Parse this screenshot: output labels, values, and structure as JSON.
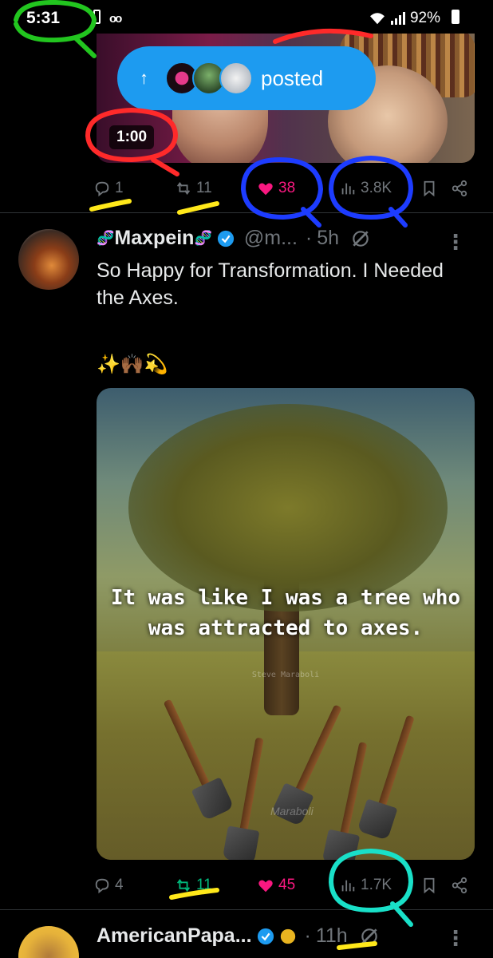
{
  "status_bar": {
    "time": "5:31",
    "battery": "92%",
    "icons": [
      "voicemail-icon",
      "wifi-icon",
      "signal-icon",
      "battery-icon"
    ]
  },
  "top_tweet": {
    "video_duration": "1:00",
    "actions": {
      "replies": "1",
      "reposts": "11",
      "likes": "38",
      "views": "3.8K"
    }
  },
  "posted_pill": {
    "text": "posted"
  },
  "tweet_main": {
    "name": "Maxpein",
    "handle": "@m...",
    "time": "5h",
    "text": "So Happy for Transformation. I Needed the Axes.",
    "emojis": "✨🙌🏾💫",
    "image": {
      "quote": "It was like I was a tree who was attracted to axes.",
      "quote_author": "Steve Maraboli",
      "watermark": "Maraboli"
    },
    "actions": {
      "replies": "4",
      "reposts": "11",
      "likes": "45",
      "views": "1.7K"
    }
  },
  "tweet_next": {
    "name": "AmericanPapa...",
    "time": "11h"
  },
  "colors": {
    "accent": "#1d9bf0",
    "like": "#f91880",
    "repost": "#00ba7c",
    "muted": "#71767b",
    "annotation_green": "#22c51f",
    "annotation_red": "#ff2a2a",
    "annotation_blue": "#1d3cff",
    "annotation_yellow": "#ffe81a",
    "annotation_cyan": "#19e0c8"
  }
}
